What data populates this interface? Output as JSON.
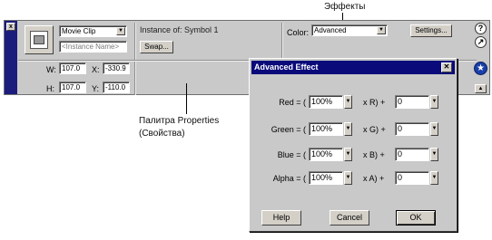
{
  "annotations": {
    "effects_label": "Эффекты",
    "palette_label_line1": "Палитра Properties",
    "palette_label_line2": "(Свойства)"
  },
  "properties_panel": {
    "close_glyph": "x",
    "symbol_type_value": "Movie Clip",
    "instance_name_placeholder": "<Instance Name>",
    "instance_of_text": "Instance of: Symbol 1",
    "swap_button_label": "Swap...",
    "color_label": "Color:",
    "color_value": "Advanced",
    "settings_button_label": "Settings...",
    "help_glyph": "?",
    "arrow_glyph": "↗",
    "size": {
      "w_label": "W:",
      "w_value": "107.0",
      "h_label": "H:",
      "h_value": "107.0",
      "x_label": "X:",
      "x_value": "-330.9",
      "y_label": "Y:",
      "y_value": "-110.0"
    },
    "collapse_glyph": "▲"
  },
  "dialog": {
    "title": "Advanced Effect",
    "close_glyph": "✕",
    "rows": [
      {
        "left_label": "Red = (",
        "left_value": "100%",
        "mid_label": "x R) +",
        "right_value": "0"
      },
      {
        "left_label": "Green = (",
        "left_value": "100%",
        "mid_label": "x G) +",
        "right_value": "0"
      },
      {
        "left_label": "Blue = (",
        "left_value": "100%",
        "mid_label": "x B) +",
        "right_value": "0"
      },
      {
        "left_label": "Alpha = (",
        "left_value": "100%",
        "mid_label": "x A) +",
        "right_value": "0"
      }
    ],
    "dropdown_glyph": "▼",
    "help_button_label": "Help",
    "cancel_button_label": "Cancel",
    "ok_button_label": "OK"
  }
}
